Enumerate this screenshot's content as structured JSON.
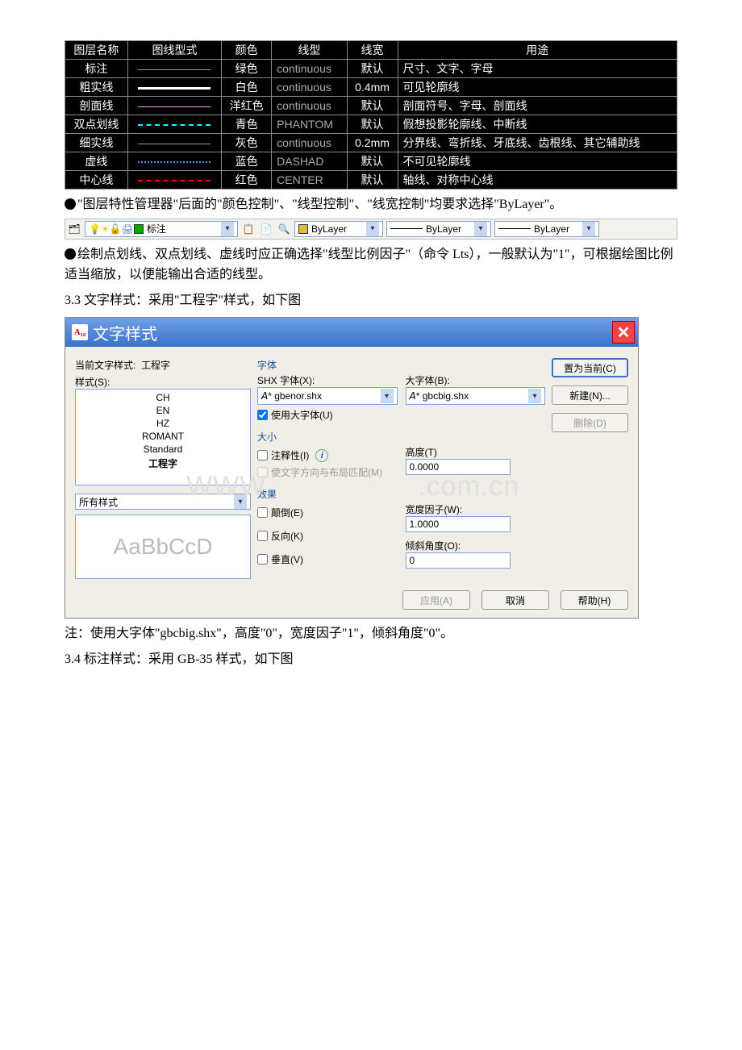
{
  "table": {
    "headers": [
      "图层名称",
      "图线型式",
      "颜色",
      "线型",
      "线宽",
      "用途"
    ],
    "rows": [
      {
        "name": "标注",
        "color": "绿色",
        "colorClass": "color-green",
        "ltype": "continuous",
        "lw": "默认",
        "use": "尺寸、文字、字母",
        "sample": "ls-thin"
      },
      {
        "name": "粗实线",
        "color": "白色",
        "colorClass": "color-white",
        "ltype": "continuous",
        "lw": "0.4mm",
        "use": "可见轮廓线",
        "sample": "ls-thick"
      },
      {
        "name": "剖面线",
        "color": "洋红色",
        "colorClass": "color-magenta",
        "ltype": "continuous",
        "lw": "默认",
        "use": "剖面符号、字母、剖面线",
        "sample": "ls-thin"
      },
      {
        "name": "双点划线",
        "color": "青色",
        "colorClass": "color-cyan",
        "ltype": "PHANTOM",
        "lw": "默认",
        "use": "假想投影轮廓线、中断线",
        "sample": "ls-dashed"
      },
      {
        "name": "细实线",
        "color": "灰色",
        "colorClass": "color-grayc",
        "ltype": "continuous",
        "lw": "0.2mm",
        "use": "分界线、弯折线、牙底线、齿根线、其它辅助线",
        "sample": "ls-thin"
      },
      {
        "name": "虚线",
        "color": "蓝色",
        "colorClass": "color-blue",
        "ltype": "DASHAD",
        "lw": "默认",
        "use": "不可见轮廓线",
        "sample": "ls-dotted"
      },
      {
        "name": "中心线",
        "color": "红色",
        "colorClass": "color-red",
        "ltype": "CENTER",
        "lw": "默认",
        "use": "轴线、对称中心线",
        "sample": "ls-dashed"
      }
    ]
  },
  "para1": "\"图层特性管理器\"后面的\"颜色控制\"、\"线型控制\"、\"线宽控制\"均要求选择\"ByLayer\"。",
  "toolbar": {
    "layer_label": "标注",
    "color_label": "ByLayer",
    "linetype_label": "ByLayer",
    "lineweight_label": "ByLayer"
  },
  "para2": "绘制点划线、双点划线、虚线时应正确选择\"线型比例因子\"（命令 Lts），一般默认为\"1\"，可根据绘图比例适当缩放，以便能输出合适的线型。",
  "para3": "3.3 文字样式：采用\"工程字\"样式，如下图",
  "dialog": {
    "title": "文字样式",
    "current_label": "当前文字样式:",
    "current_value": "工程字",
    "styles_label": "样式(S):",
    "styles": [
      "CH",
      "EN",
      "HZ",
      "ROMANT",
      "Standard",
      "工程字"
    ],
    "selected_style": "工程字",
    "filter_label": "所有样式",
    "preview": "AaBbCcD",
    "font_group": "字体",
    "shx_label": "SHX 字体(X):",
    "shx_value": "gbenor.shx",
    "big_label": "大字体(B):",
    "big_value": "gbcbig.shx",
    "use_big": "使用大字体(U)",
    "size_group": "大小",
    "annotative": "注释性(I)",
    "match_orient": "使文字方向与布局匹配(M)",
    "height_label": "高度(T)",
    "height_value": "0.0000",
    "effect_group": "效果",
    "upside": "颠倒(E)",
    "backwards": "反向(K)",
    "vertical": "垂直(V)",
    "width_label": "宽度因子(W):",
    "width_value": "1.0000",
    "oblique_label": "倾斜角度(O):",
    "oblique_value": "0",
    "btn_current": "置为当前(C)",
    "btn_new": "新建(N)...",
    "btn_delete": "删除(D)",
    "btn_apply": "应用(A)",
    "btn_cancel": "取消",
    "btn_help": "帮助(H)"
  },
  "note": "注：使用大字体\"gbcbig.shx\"，高度\"0\"，宽度因子\"1\"，倾斜角度\"0\"。",
  "para4": "3.4 标注样式：采用 GB-35 样式，如下图"
}
